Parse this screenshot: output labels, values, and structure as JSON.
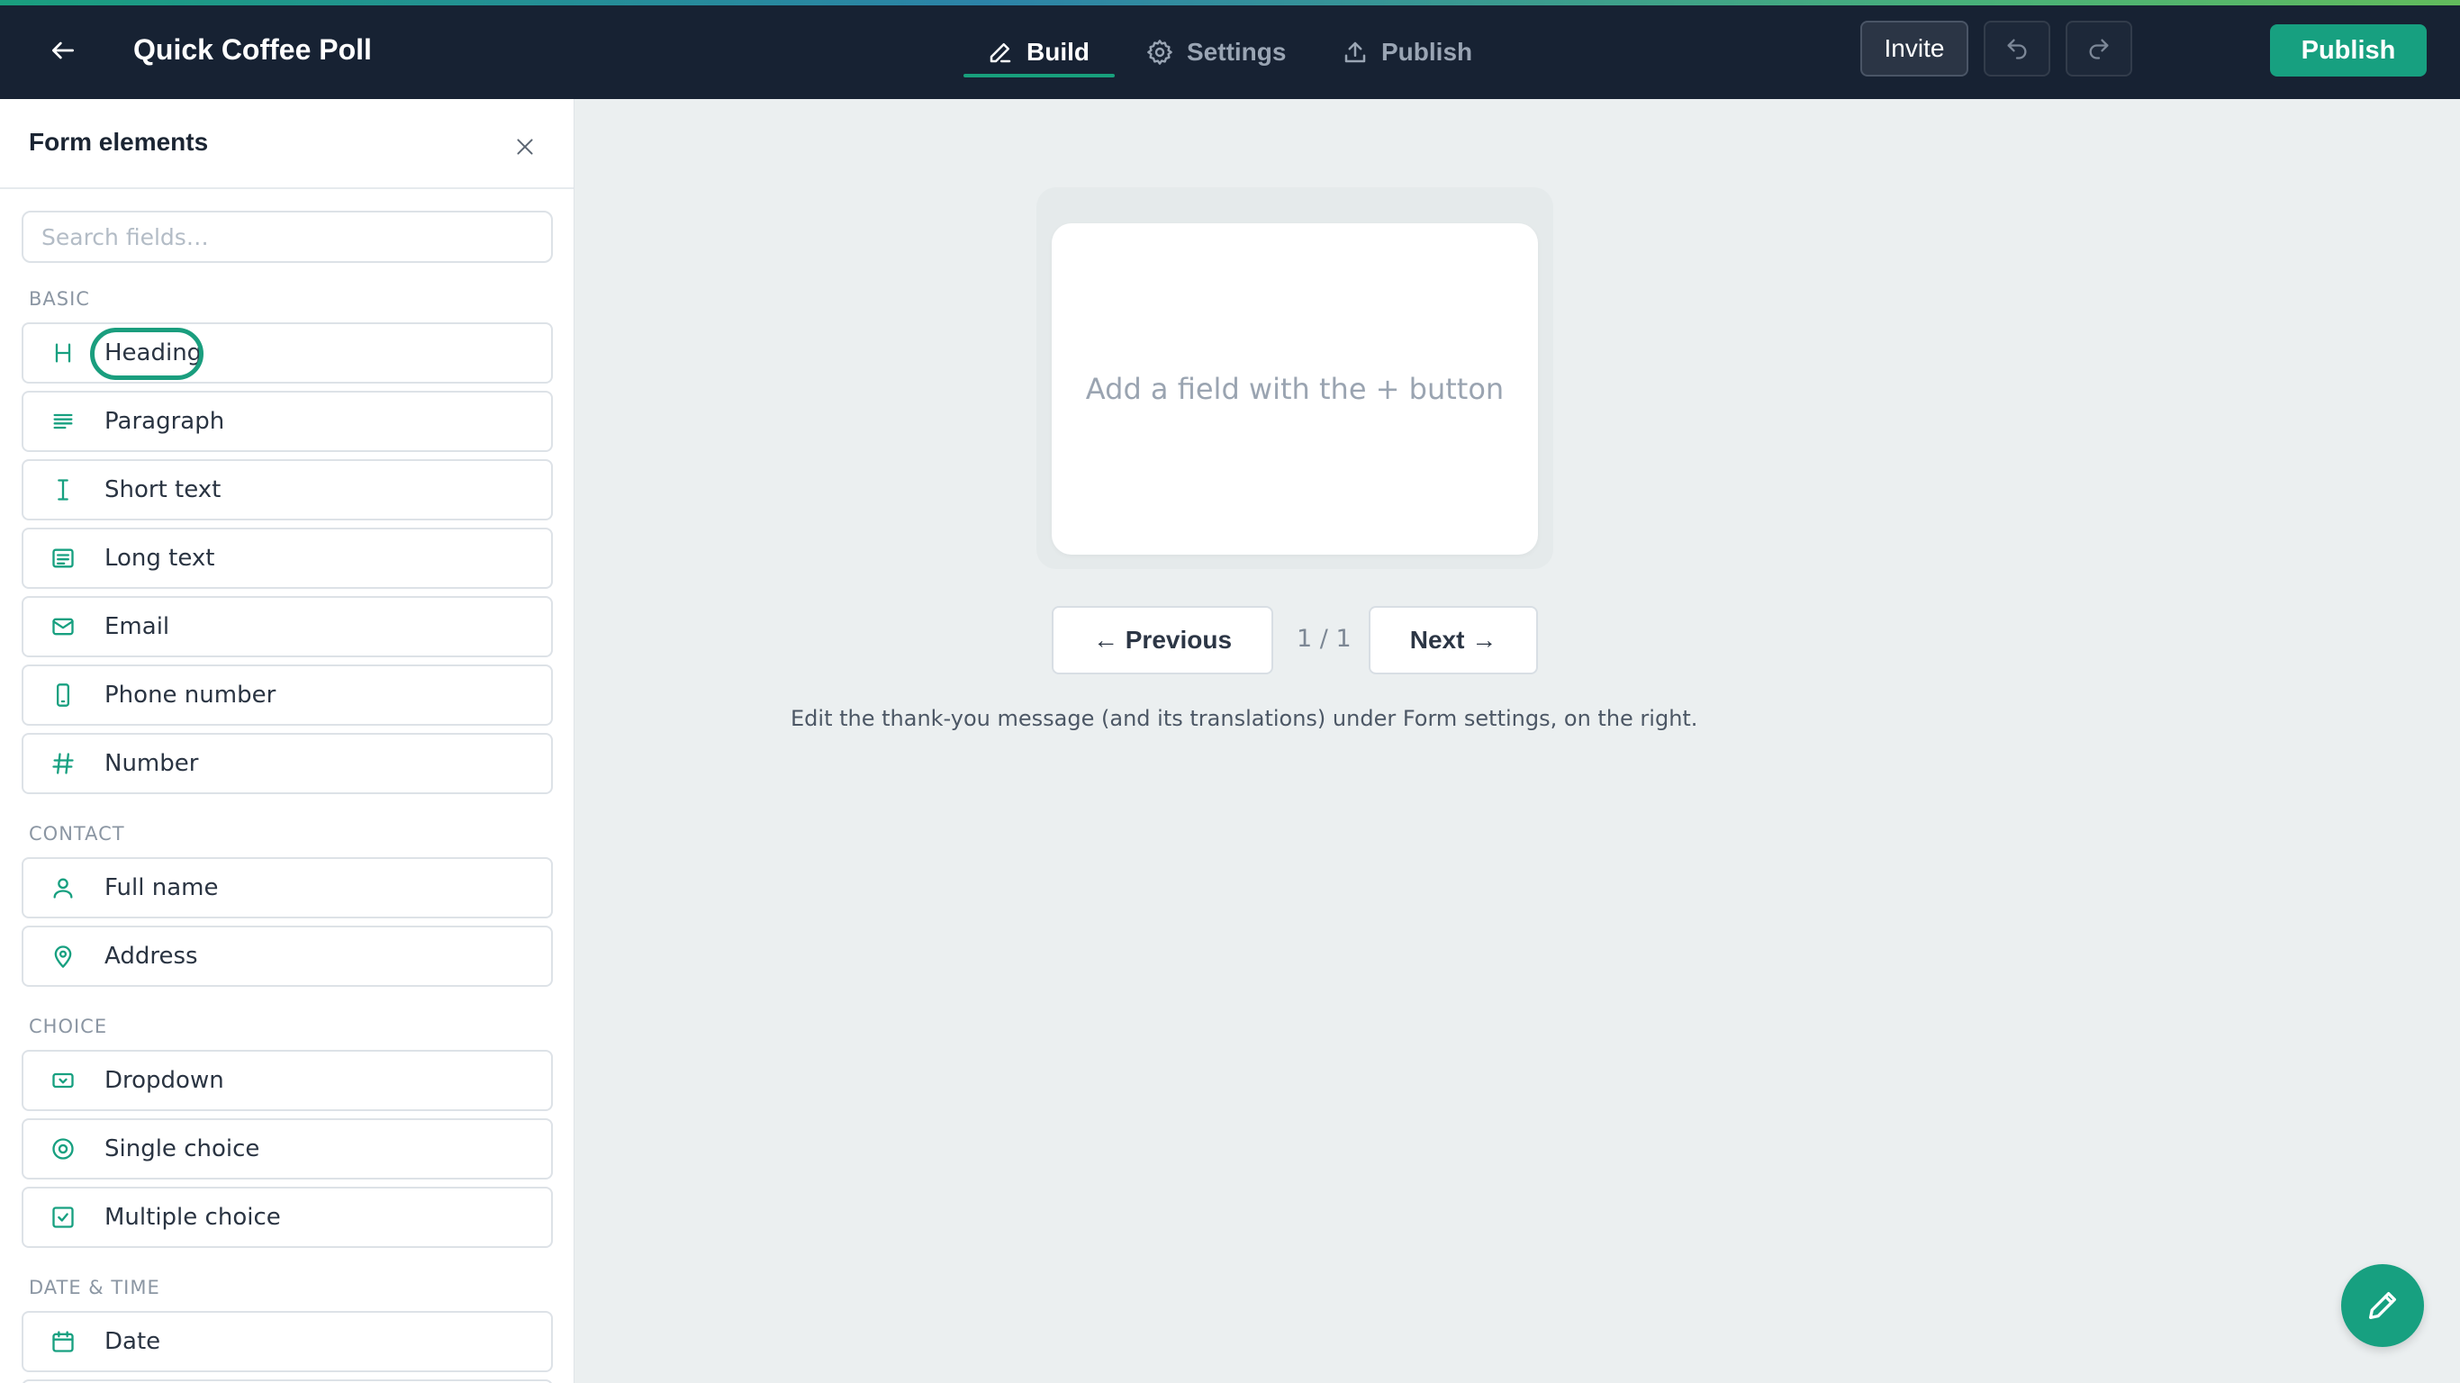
{
  "header": {
    "back_icon": "arrow-left-icon",
    "title": "Quick Coffee Poll",
    "tabs": [
      {
        "label": "Build",
        "icon": "pencil-icon",
        "active": true
      },
      {
        "label": "Settings",
        "icon": "gear-icon",
        "active": false
      },
      {
        "label": "Publish",
        "icon": "upload-icon",
        "active": false
      }
    ],
    "invite_label": "Invite",
    "undo_icon": "undo-icon",
    "redo_icon": "redo-icon",
    "publish_label": "Publish"
  },
  "sidebar": {
    "title": "Form elements",
    "close_icon": "close-icon",
    "search_placeholder": "Search fields…",
    "sections": [
      {
        "label": "BASIC",
        "items": [
          {
            "label": "Heading",
            "icon": "heading-icon"
          },
          {
            "label": "Paragraph",
            "icon": "paragraph-icon"
          },
          {
            "label": "Short text",
            "icon": "text-cursor-icon"
          },
          {
            "label": "Long text",
            "icon": "long-text-icon"
          },
          {
            "label": "Email",
            "icon": "envelope-icon"
          },
          {
            "label": "Phone number",
            "icon": "phone-icon"
          },
          {
            "label": "Number",
            "icon": "hash-icon"
          }
        ]
      },
      {
        "label": "CONTACT",
        "items": [
          {
            "label": "Full name",
            "icon": "user-icon"
          },
          {
            "label": "Address",
            "icon": "map-pin-icon"
          }
        ]
      },
      {
        "label": "CHOICE",
        "items": [
          {
            "label": "Dropdown",
            "icon": "dropdown-icon"
          },
          {
            "label": "Single choice",
            "icon": "radio-icon"
          },
          {
            "label": "Multiple choice",
            "icon": "checkbox-icon"
          }
        ]
      },
      {
        "label": "DATE & TIME",
        "items": [
          {
            "label": "Date",
            "icon": "calendar-icon"
          }
        ]
      }
    ]
  },
  "canvas": {
    "empty_message": "Add a field with the + button",
    "previous_label": "← Previous",
    "page_counter": "1 / 1",
    "next_label": "Next →",
    "helper_text": "Edit the thank-you message (and its translations) under Form settings, on the right."
  },
  "fab_icon": "pencil-icon",
  "colors": {
    "accent": "#17a080",
    "topbar": "#172233",
    "canvas": "#ebeff0"
  }
}
